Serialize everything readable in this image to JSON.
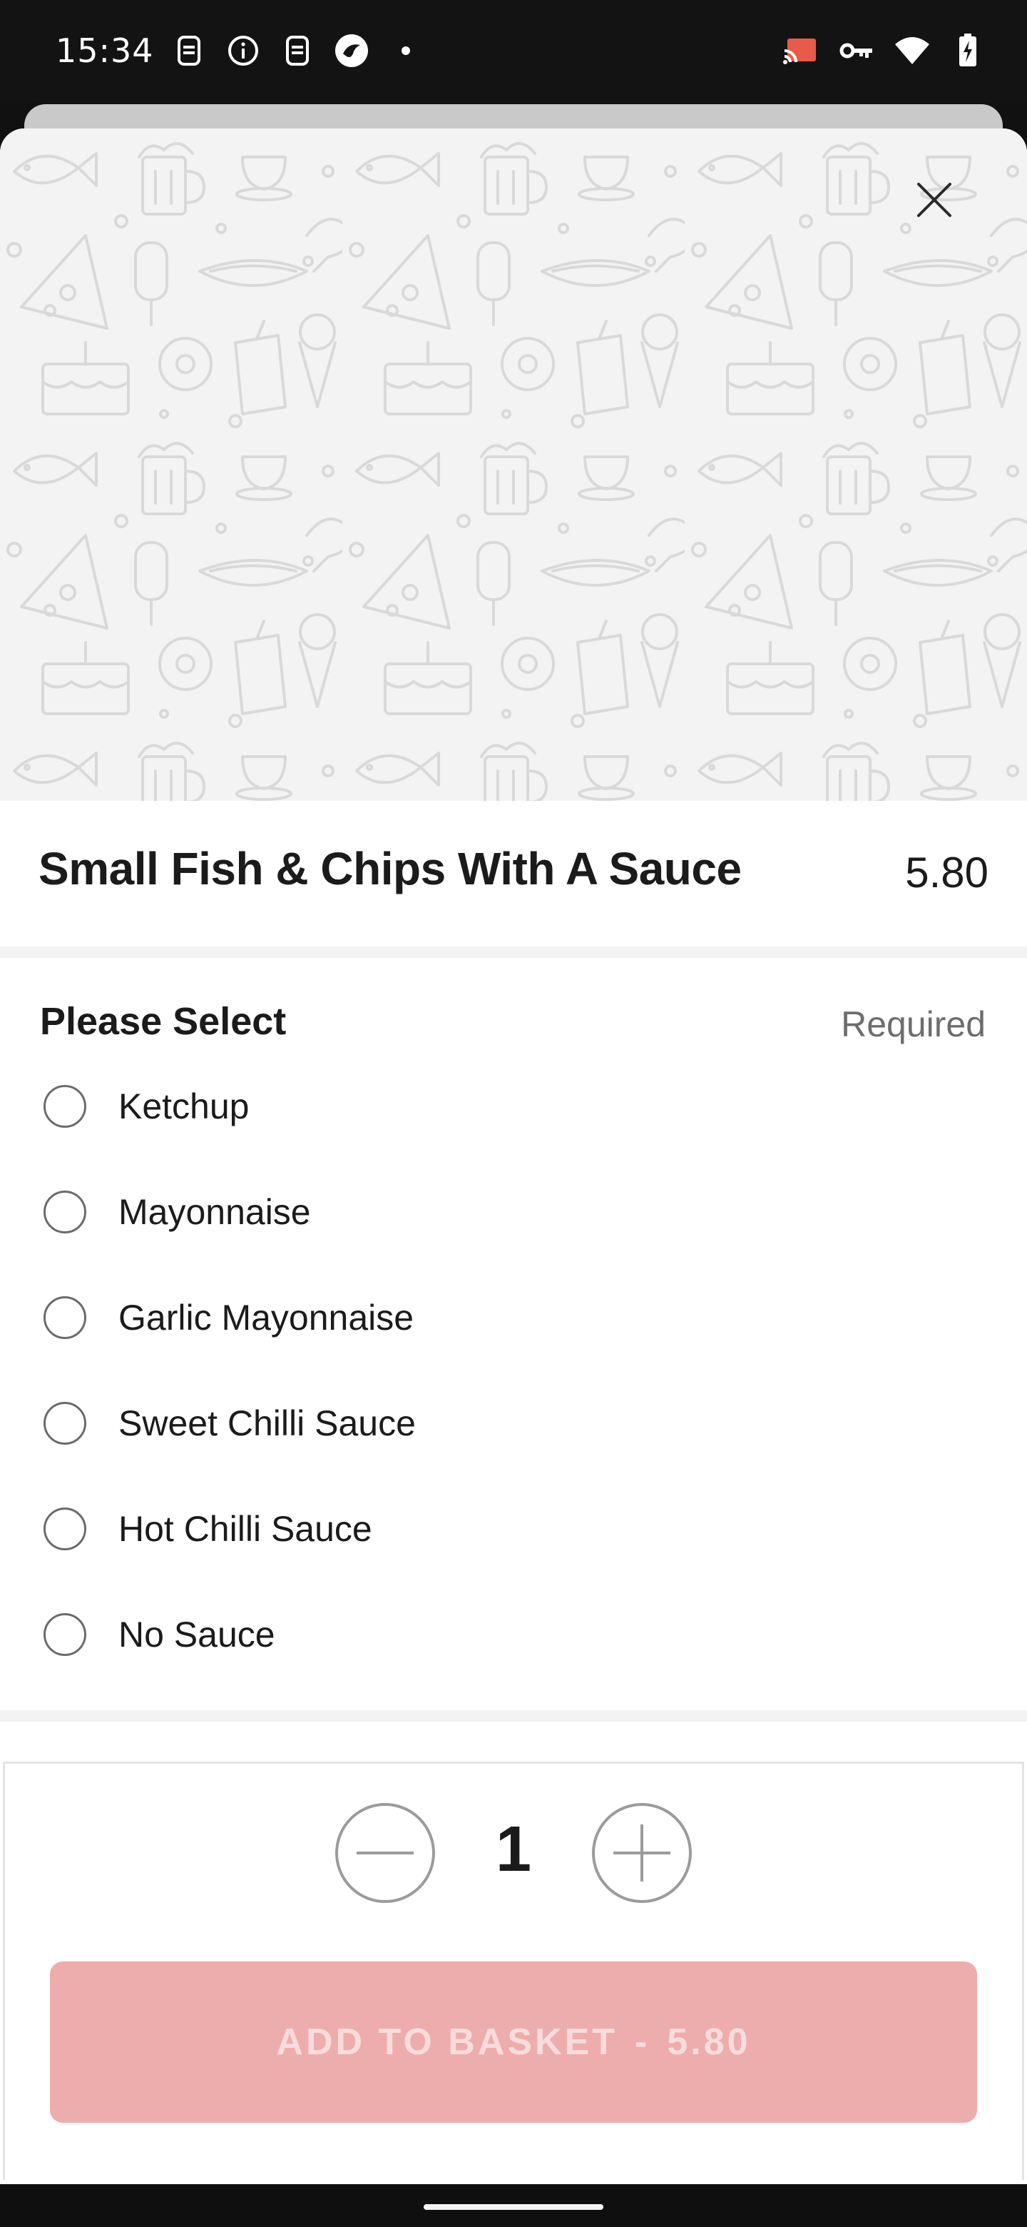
{
  "status_bar": {
    "time": "15:34",
    "left_icons": [
      "sim-icon",
      "info-icon",
      "sim-icon",
      "app-icon",
      "dot-icon"
    ],
    "right_icons": [
      "cast-icon",
      "vpn-key-icon",
      "wifi-icon",
      "battery-charging-icon"
    ]
  },
  "sheet": {
    "close_icon": "close-icon",
    "item": {
      "title": "Small Fish & Chips With A Sauce",
      "price": "5.80"
    },
    "options_group": {
      "heading": "Please Select",
      "required_label": "Required",
      "options": [
        {
          "label": "Ketchup",
          "selected": false
        },
        {
          "label": "Mayonnaise",
          "selected": false
        },
        {
          "label": "Garlic Mayonnaise",
          "selected": false
        },
        {
          "label": "Sweet Chilli Sauce",
          "selected": false
        },
        {
          "label": "Hot Chilli Sauce",
          "selected": false
        },
        {
          "label": "No Sauce",
          "selected": false
        }
      ]
    }
  },
  "footer": {
    "quantity": "1",
    "decrement_icon": "minus-icon",
    "increment_icon": "plus-icon",
    "add_button": {
      "label": "ADD TO BASKET",
      "separator": "-",
      "price": "5.80"
    }
  },
  "colors": {
    "accent_disabled": "#eeadad",
    "accent_text": "#f8dcdc",
    "pattern_bg": "#f3f3f3"
  }
}
